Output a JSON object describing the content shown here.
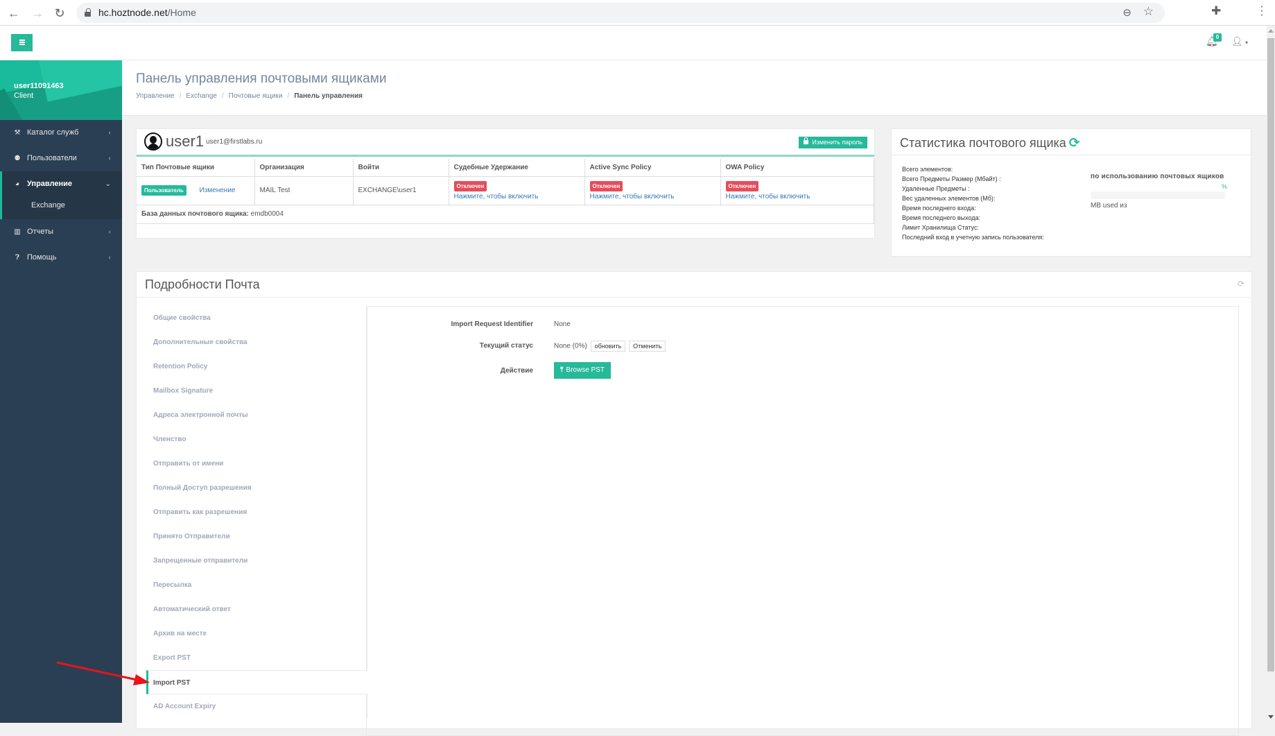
{
  "browser": {
    "url_host": "hc.hoztnode.net",
    "url_path": "/Home",
    "icons": {
      "back": "back-arrow-icon",
      "forward": "forward-arrow-icon",
      "reload": "reload-icon",
      "zoom": "zoom-out-icon",
      "bookmark": "star-icon",
      "extensions": "puzzle-icon",
      "menu": "kebab-menu-icon"
    }
  },
  "topbar": {
    "notification_count": "0"
  },
  "sidebar": {
    "username": "user11091463",
    "role": "Client",
    "items": [
      {
        "label": "Каталог служб",
        "icon": "gavel-icon",
        "glyph": "🔨"
      },
      {
        "label": "Пользователи",
        "icon": "users-icon",
        "glyph": "👥"
      },
      {
        "label": "Управление",
        "icon": "globe-icon",
        "glyph": "●",
        "active": true
      },
      {
        "label": "Отчеты",
        "icon": "bar-chart-icon",
        "glyph": "▥"
      },
      {
        "label": "Помощь",
        "icon": "question-icon",
        "glyph": "?"
      }
    ],
    "submenu": [
      "Exchange"
    ]
  },
  "page": {
    "title": "Панель управления почтовыми ящиками",
    "breadcrumb": [
      "Управление",
      "Exchange",
      "Почтовые ящики",
      "Панель управления"
    ]
  },
  "user_panel": {
    "name": "user1",
    "email": "user1@firstlabs.ru",
    "change_password_label": "Изменить пароль",
    "columns": [
      "Тип Почтовые ящики",
      "Организация",
      "Войти",
      "Судебные Удержание",
      "Active Sync Policy",
      "OWA Policy"
    ],
    "row": {
      "type_badge": "Пользователь",
      "type_link": "Изменение",
      "organization": "MAIL Test",
      "login": "EXCHANGE\\user1",
      "litigation_status": "Отключен",
      "litigation_link": "Нажмите, чтобы включить",
      "activesync_status": "Отключен",
      "activesync_link": "Нажмите, чтобы включить",
      "owa_status": "Отключен",
      "owa_link": "Нажмите, чтобы включить"
    },
    "database_label": "База данных почтового ящика:",
    "database_value": "emdb0004"
  },
  "stats_panel": {
    "title": "Статистика почтового ящика",
    "labels": [
      "Всего элементов:",
      "Всего Предметы Размер (Мбайт) :",
      "Удаленные Предметы :",
      "Вес удаленных элементов (Мб):",
      "Время последнего входа:",
      "Время последнего выхода:",
      "Лимит Хранилища Статус:",
      "Последний вход в учетную запись пользователя:"
    ],
    "usage_title": "по использованию почтовых ящиков",
    "usage_percent_text": "%",
    "usage_percent_value": 0,
    "usage_used_text": "MB used из"
  },
  "details_panel": {
    "title": "Подробности Почта",
    "tabs": [
      "Общие свойства",
      "Дополнительные свойства",
      "Retention Policy",
      "Mailbox Signature",
      "Адреса электронной почты",
      "Членство",
      "Отправить от имени",
      "Полный Доступ разрешения",
      "Отправить как разрешения",
      "Принято Отправители",
      "Запрещенные отправители",
      "Пересылка",
      "Автоматический ответ",
      "Архив на месте",
      "Export PST",
      "Import PST",
      "AD Account Expiry"
    ],
    "active_tab": "Import PST",
    "import": {
      "identifier_label": "Import Request Identifier",
      "identifier_value": "None",
      "status_label": "Текущий статус",
      "status_value": "None (0%)",
      "refresh_label": "обновить",
      "cancel_label": "Отменить",
      "action_label": "Действие",
      "browse_label": "Browse PST"
    }
  },
  "colors": {
    "accent": "#26b99a",
    "sidebar": "#2a3f54",
    "danger": "#e74c5b",
    "link": "#337ab7",
    "annotation_arrow": "#e8141c"
  }
}
